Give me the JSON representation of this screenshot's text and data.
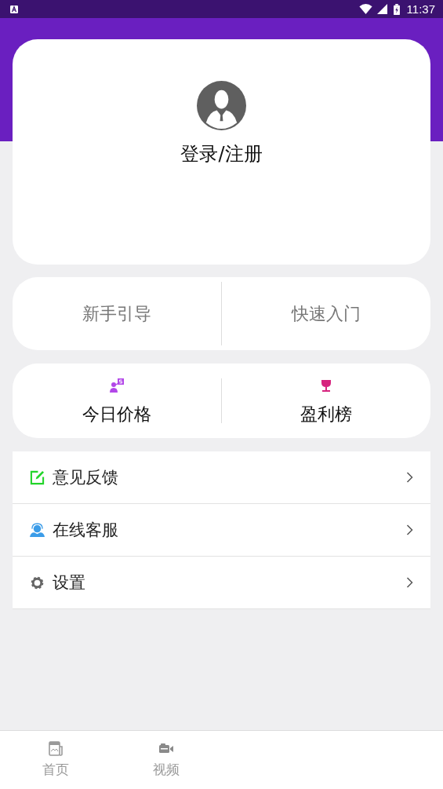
{
  "status_bar": {
    "time": "11:37"
  },
  "profile": {
    "login_label": "登录/注册"
  },
  "guide_links": [
    {
      "label": "新手引导"
    },
    {
      "label": "快速入门"
    }
  ],
  "feature_links": [
    {
      "kind": "price",
      "label": "今日价格"
    },
    {
      "kind": "ranking",
      "label": "盈利榜"
    }
  ],
  "menu": [
    {
      "kind": "feedback",
      "label": "意见反馈"
    },
    {
      "kind": "service",
      "label": "在线客服"
    },
    {
      "kind": "settings",
      "label": "设置"
    }
  ],
  "tab_bar": [
    {
      "kind": "home",
      "label": "首页",
      "selected": false
    },
    {
      "kind": "video",
      "label": "视频",
      "selected": false
    }
  ]
}
